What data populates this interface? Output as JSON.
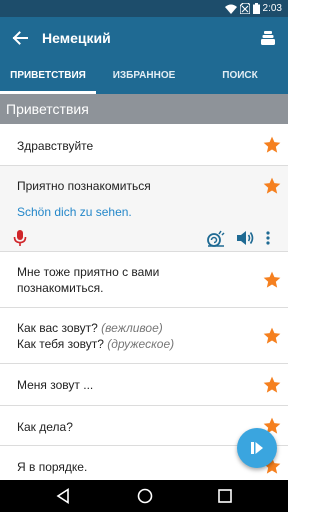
{
  "status": {
    "time": "2:03"
  },
  "header": {
    "title": "Немецкий"
  },
  "tabs": [
    {
      "label": "ПРИВЕТСТВИЯ"
    },
    {
      "label": "ИЗБРАННОЕ"
    },
    {
      "label": "ПОИСК"
    }
  ],
  "section": {
    "title": "Приветствия"
  },
  "phrases": [
    {
      "line1": "Здравствуйте"
    },
    {
      "line1": "Приятно познакомиться",
      "translation": "Schön dich zu sehen."
    },
    {
      "line1": "Мне тоже приятно с вами",
      "line2": "познакомиться."
    },
    {
      "line1": "Как вас зовут?",
      "note1": "(вежливое)",
      "line2": "Как тебя зовут?",
      "note2": "(дружеское)"
    },
    {
      "line1": "Меня зовут ..."
    },
    {
      "line1": "Как дела?"
    },
    {
      "line1": "Я в порядке."
    }
  ],
  "colors": {
    "status_bar": "#1d4d6b",
    "app_bar": "#1f6a93",
    "section_header": "#8e9399",
    "star": "#f5801f",
    "translation": "#2487c9",
    "mic": "#d0262b",
    "fab": "#3aa5df"
  }
}
